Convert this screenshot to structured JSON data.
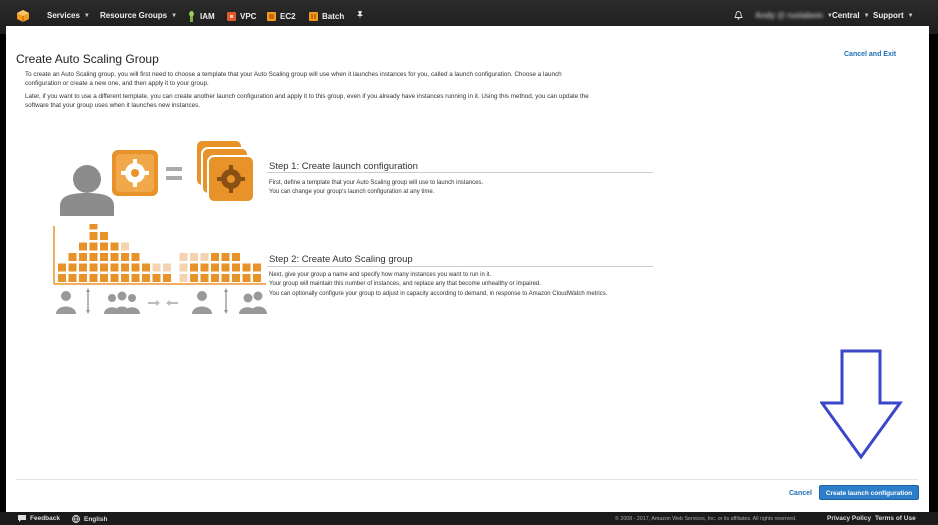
{
  "topbar": {
    "services_label": "Services",
    "resource_groups_label": "Resource Groups",
    "shortcuts": [
      {
        "label": "IAM",
        "icon": "iam-icon"
      },
      {
        "label": "VPC",
        "icon": "vpc-icon"
      },
      {
        "label": "EC2",
        "icon": "ec2-icon"
      },
      {
        "label": "Batch",
        "icon": "batch-icon"
      }
    ],
    "account_label": "Andy @ ruslabem",
    "region_label": "Central",
    "support_label": "Support"
  },
  "page": {
    "title": "Create Auto Scaling Group",
    "cancel_and_exit": "Cancel and Exit",
    "intro_1": "To create an Auto Scaling group, you will first need to choose a template that your Auto Scaling group will use when it launches instances for you, called a launch configuration. Choose a launch configuration or create a new one, and then apply it to your group.",
    "intro_2": "Later, if you want to use a different template, you can create another launch configuration and apply it to this group, even if you already have instances running in it. Using this method, you can update the software that your group uses when it launches new instances."
  },
  "step1": {
    "title": "Step 1: Create launch configuration",
    "line1": "First, define a template that your Auto Scaling group will use to launch instances.",
    "line2": "You can change your group's launch configuration at any time."
  },
  "step2": {
    "title": "Step 2: Create Auto Scaling group",
    "line1": "Next, give your group a name and specify how many instances you want to run in it.",
    "line2": "Your group will maintain this number of instances, and replace any that become unhealthy or impaired.",
    "line3": "You can optionally configure your group to adjust in capacity according to demand, in response to Amazon CloudWatch metrics."
  },
  "actions": {
    "cancel": "Cancel",
    "create_launch_configuration": "Create launch configuration"
  },
  "footer": {
    "feedback": "Feedback",
    "language": "English",
    "copyright": "© 2008 - 2017, Amazon Web Services, Inc. or its affiliates. All rights reserved.",
    "privacy": "Privacy Policy",
    "terms": "Terms of Use"
  },
  "colors": {
    "topbar": "#232323",
    "orange": "#e8922a",
    "light_orange": "#f3d3b0",
    "link": "#1f6fb5",
    "primary_button": "#2d7ec8",
    "annotation_arrow": "#3a47c8"
  }
}
